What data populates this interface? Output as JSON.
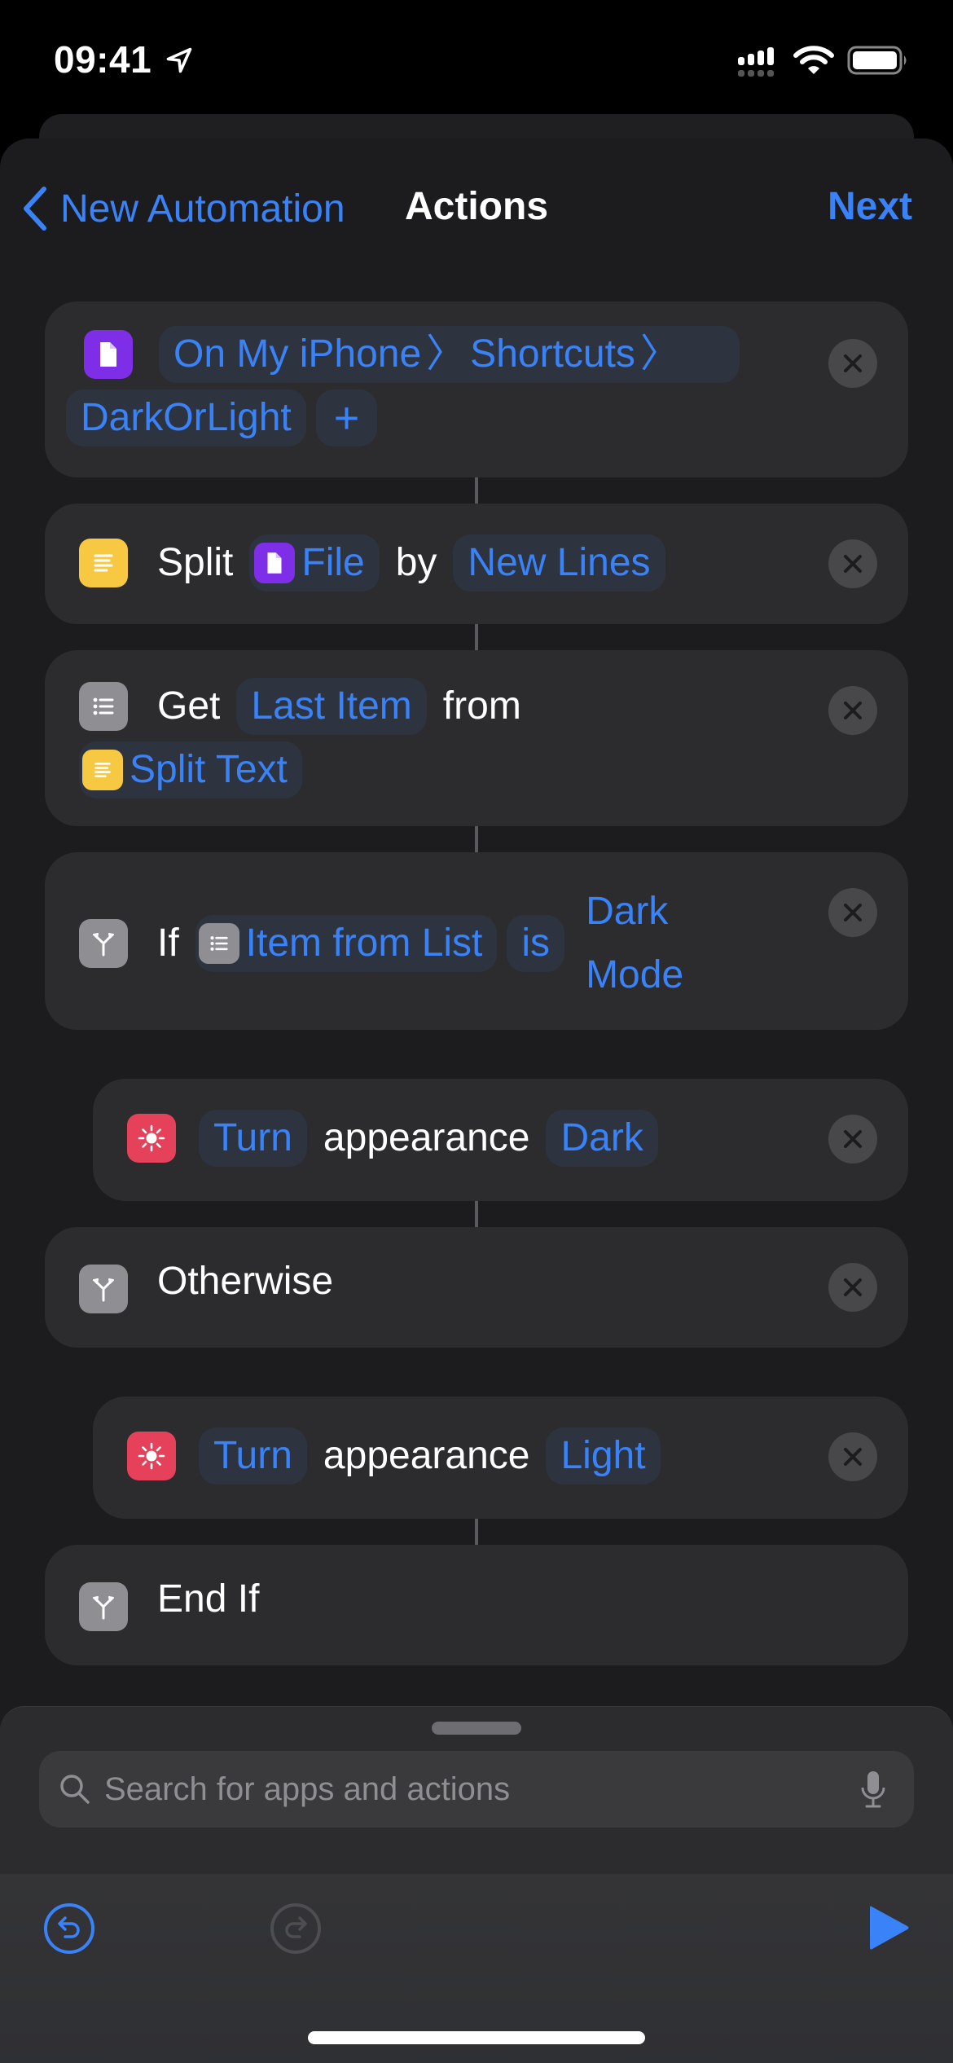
{
  "status_bar": {
    "time": "09:41",
    "icons": [
      "location-arrow-icon",
      "cellular-signal-icon",
      "wifi-icon",
      "battery-icon"
    ]
  },
  "nav": {
    "back_label": "New Automation",
    "title": "Actions",
    "next_label": "Next"
  },
  "colors": {
    "accent": "#3a82f7",
    "background": "#1c1c1e",
    "card": "#2c2c2e",
    "token_bg": "#2d3440",
    "files_icon": "#7d2ee6",
    "text_icon": "#f7c942",
    "scripting_icon": "#8e8e93",
    "appearance_icon": "#e5415a"
  },
  "actions": [
    {
      "icon": "file-icon",
      "tokens": [
        "On My iPhone",
        "Shortcuts",
        "DarkOrLight",
        "+"
      ],
      "path_separator": "〉"
    },
    {
      "icon": "text-icon",
      "verb": "Split",
      "input_token": "File",
      "word_by": "by",
      "separator_token": "New Lines"
    },
    {
      "icon": "list-icon",
      "verb": "Get",
      "item_token": "Last Item",
      "word_from": "from",
      "source_token": "Split Text"
    },
    {
      "icon": "branch-icon",
      "verb": "If",
      "input_token": "Item from List",
      "condition_token": "is",
      "value_token": "Dark Mode"
    },
    {
      "icon": "sun-icon",
      "turn_token": "Turn",
      "word": "appearance",
      "value_token": "Dark"
    },
    {
      "icon": "branch-icon",
      "label": "Otherwise"
    },
    {
      "icon": "sun-icon",
      "turn_token": "Turn",
      "word": "appearance",
      "value_token": "Light"
    },
    {
      "icon": "branch-icon",
      "label": "End If"
    }
  ],
  "search": {
    "placeholder": "Search for apps and actions",
    "value": ""
  },
  "toolbar": {
    "undo_enabled": true,
    "redo_enabled": false
  }
}
